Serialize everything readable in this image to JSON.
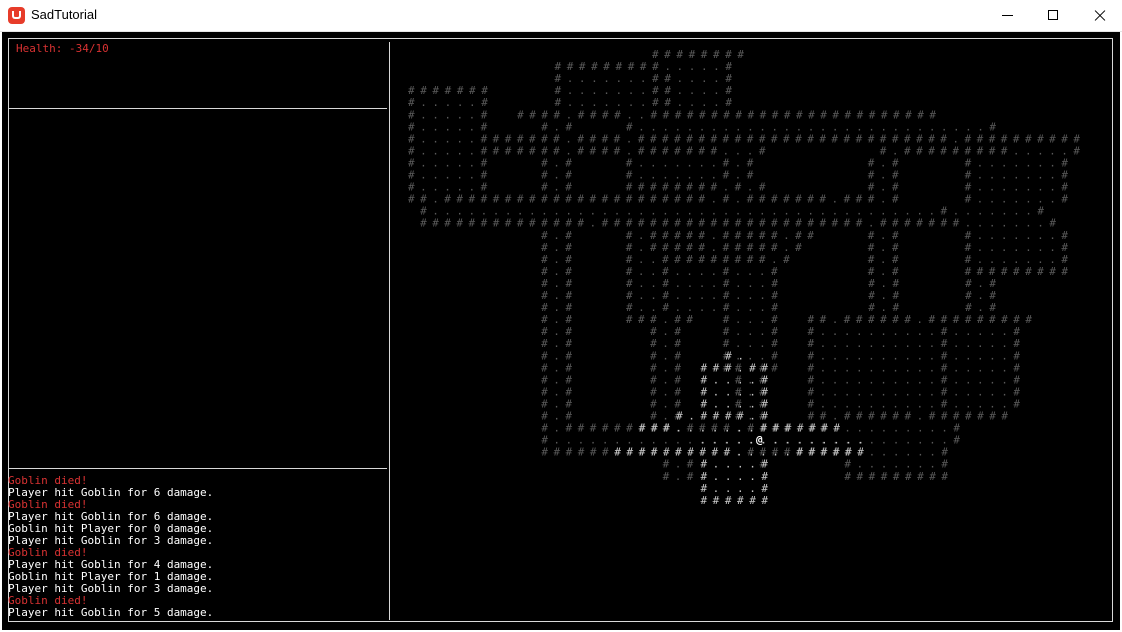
{
  "window": {
    "title": "SadTutorial",
    "minimize_icon": "minimize-icon",
    "maximize_icon": "maximize-icon",
    "close_icon": "close-icon"
  },
  "colors": {
    "health": "#d83232",
    "log_normal": "#ffffff",
    "log_died": "#d83232",
    "map_seen": "#5a5a5a",
    "map_visible": "#c8c8c8",
    "player": "#ffffff",
    "background": "#000000"
  },
  "status": {
    "health": "Health: -34/10"
  },
  "log": [
    {
      "text": "Goblin died!",
      "kind": "died"
    },
    {
      "text": "Player hit Goblin for 6 damage.",
      "kind": "normal"
    },
    {
      "text": "Goblin died!",
      "kind": "died"
    },
    {
      "text": "Player hit Goblin for 6 damage.",
      "kind": "normal"
    },
    {
      "text": "Goblin hit Player for 0 damage.",
      "kind": "normal"
    },
    {
      "text": "Player hit Goblin for 3 damage.",
      "kind": "normal"
    },
    {
      "text": "Goblin died!",
      "kind": "died"
    },
    {
      "text": "Player hit Goblin for 4 damage.",
      "kind": "normal"
    },
    {
      "text": "Goblin hit Player for 1 damage.",
      "kind": "normal"
    },
    {
      "text": "Player hit Goblin for 3 damage.",
      "kind": "normal"
    },
    {
      "text": "Goblin died!",
      "kind": "died"
    },
    {
      "text": "Player hit Goblin for 5 damage.",
      "kind": "normal"
    }
  ],
  "map": {
    "seen": [
      "                    ########",
      "            #########.....#",
      "            #.......##....#",
      "#######     #.......##....#",
      "#.....#     #.......##....#",
      "#.....#  ####.####..########################",
      "#.....#    #.#    #.............................#",
      "#.....#######.####.##########################.##########",
      "#.....#######.####.#######...#         #.#########.....#",
      "#.....#    #.#    #.......#.#         #.#     #.......#",
      "#.....#    #.#    #.......#.#         #.#     #.......#",
      "#.....#    #.#    ########.#.#        #.#     #.......#",
      "##.######################.#.#######.###.#     #.......#",
      " #..........................................#.......#",
      " ##############.######################.#######.......#",
      "           #.#    #.#####.#####.##    #.#     #.......#",
      "           #.#    #.#####.#####.#     #.#     #.......#",
      "           #.#    #..#########.#      #.#     #.......#",
      "           #.#    #..#....#...#       #.#     #########",
      "           #.#    #..#....#...#       #.#     #.#",
      "           #.#    #..#....#...#       #.#     #.#",
      "           #.#    #..#....#...#       #.#     #.#",
      "           #.#    ###.##  #...#  ##.######.#########",
      "           #.#      #.#   #...#  #..........#.....#",
      "           #.#      #.#   #...#  #..........#.....#",
      "           #.#      #.#   #...#  #..........#.....#",
      "           #.#      #.#   ##.##  #..........#.....#",
      "           #.#      #.#    #.#   #..........#.....#",
      "           #.#      #.#    #.#   #..........#.....#",
      "           #.#      #.#    #.#   #..........#.....#",
      "           #.#      #.#    #.#   ##.######.#######",
      "           #.#########.####.####.##..........#",
      "           #.................................#",
      "           ##########.#.....#########.......#",
      "                     #.#     #      #.......#",
      "                     #.#            #########"
    ],
    "visible": [
      "",
      "",
      "",
      "",
      "",
      "",
      "",
      "",
      "",
      "",
      "",
      "",
      "",
      "",
      "",
      "",
      "",
      "",
      "",
      "",
      "",
      "",
      "",
      "",
      "",
      "                          #.",
      "                        ###.##",
      "                        #....#",
      "                        #....#",
      "                        #....#",
      "                      #.####.#",
      "                   ###.......#######",
      "                        ..............",
      "                 ##########.....###### ",
      "                        #....#",
      "                        #....#",
      "                        #....#",
      "                        ######"
    ],
    "player": {
      "glyph": "@",
      "row": 32,
      "col": 29
    }
  }
}
